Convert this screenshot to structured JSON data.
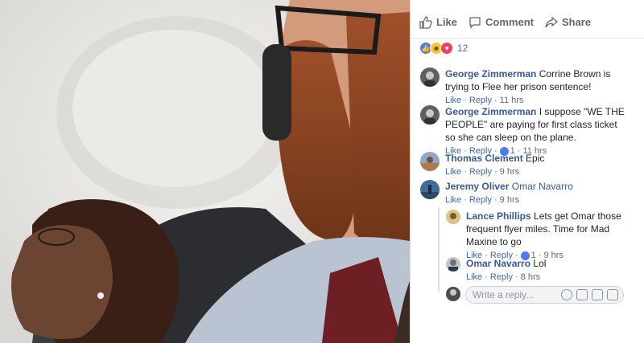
{
  "actions": {
    "like": "Like",
    "comment": "Comment",
    "share": "Share"
  },
  "reactions": {
    "count": "12"
  },
  "comments": [
    {
      "author": "George Zimmerman",
      "text": "Corrine Brown is trying to Flee her prison sentence!",
      "like": "Like",
      "reply": "Reply",
      "time": "11 hrs"
    },
    {
      "author": "George Zimmerman",
      "text": "I suppose \"WE THE PEOPLE\" are paying for first class ticket so she can sleep on the plane.",
      "like": "Like",
      "reply": "Reply",
      "likes": "1",
      "time": "11 hrs"
    },
    {
      "author": "Thomas Clement",
      "text": "Epic",
      "like": "Like",
      "reply": "Reply",
      "time": "9 hrs"
    },
    {
      "author": "Jeremy Oliver",
      "text": "Omar Navarro",
      "like": "Like",
      "reply": "Reply",
      "time": "9 hrs"
    }
  ],
  "replies": [
    {
      "author": "Lance Phillips",
      "text": "Lets get Omar those frequent flyer miles. Time for Mad Maxine to go",
      "like": "Like",
      "reply": "Reply",
      "likes": "1",
      "time": "9 hrs"
    },
    {
      "author": "Omar Navarro",
      "text": "Lol",
      "like": "Like",
      "reply": "Reply",
      "time": "8 hrs"
    }
  ],
  "reply_box": {
    "placeholder": "Write a reply..."
  },
  "colors": {
    "link": "#385898",
    "meta_link": "#4267b2",
    "like_blue": "#4b7bf0",
    "love_red": "#f33e58"
  }
}
